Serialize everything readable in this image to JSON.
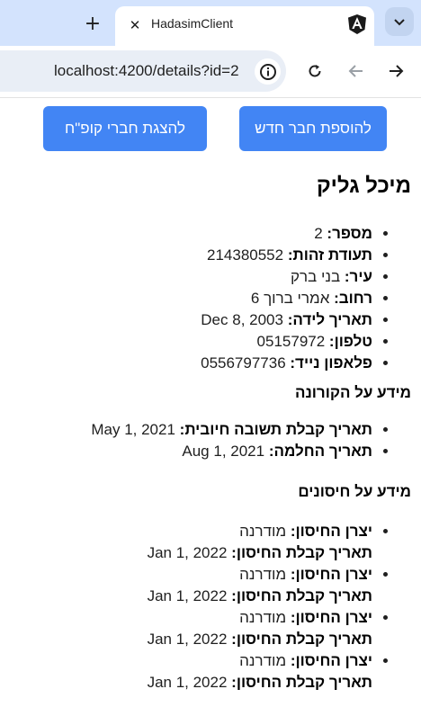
{
  "browser": {
    "new_tab_glyph": "+",
    "tab": {
      "title": "HadasimClient",
      "close_glyph": "✕",
      "favicon": "angular-icon"
    },
    "address": "localhost:4200/details?id=2",
    "colors": {
      "tabstrip": "#d3e3fd",
      "omnibox": "#e9eef6"
    }
  },
  "actions": {
    "add_member_label": "להוספת חבר חדש",
    "show_members_label": "להצגת חברי קופ\"ח",
    "button_color": "#4285f4"
  },
  "member": {
    "name": "מיכל גליק",
    "details": [
      {
        "label": "מספר:",
        "value": "2"
      },
      {
        "label": "תעודת זהות:",
        "value": "214380552"
      },
      {
        "label": "עיר:",
        "value": "בני ברק"
      },
      {
        "label": "רחוב:",
        "value": "אמרי ברוך 6"
      },
      {
        "label": "תאריך לידה:",
        "value": "Dec 8, 2003"
      },
      {
        "label": "טלפון:",
        "value": "05157972"
      },
      {
        "label": "פלאפון נייד:",
        "value": "0556797736"
      }
    ]
  },
  "corona": {
    "title": "מידע על הקורונה",
    "items": [
      {
        "label": "תאריך קבלת תשובה חיובית:",
        "value": "May 1, 2021"
      },
      {
        "label": "תאריך החלמה:",
        "value": "Aug 1, 2021"
      }
    ]
  },
  "vaccines": {
    "title": "מידע על חיסונים",
    "manufacturer_label": "יצרן החיסון:",
    "date_label": "תאריך קבלת החיסון:",
    "items": [
      {
        "manufacturer": "מודרנה",
        "date": "Jan 1, 2022"
      },
      {
        "manufacturer": "מודרנה",
        "date": "Jan 1, 2022"
      },
      {
        "manufacturer": "מודרנה",
        "date": "Jan 1, 2022"
      },
      {
        "manufacturer": "מודרנה",
        "date": "Jan 1, 2022"
      }
    ]
  }
}
